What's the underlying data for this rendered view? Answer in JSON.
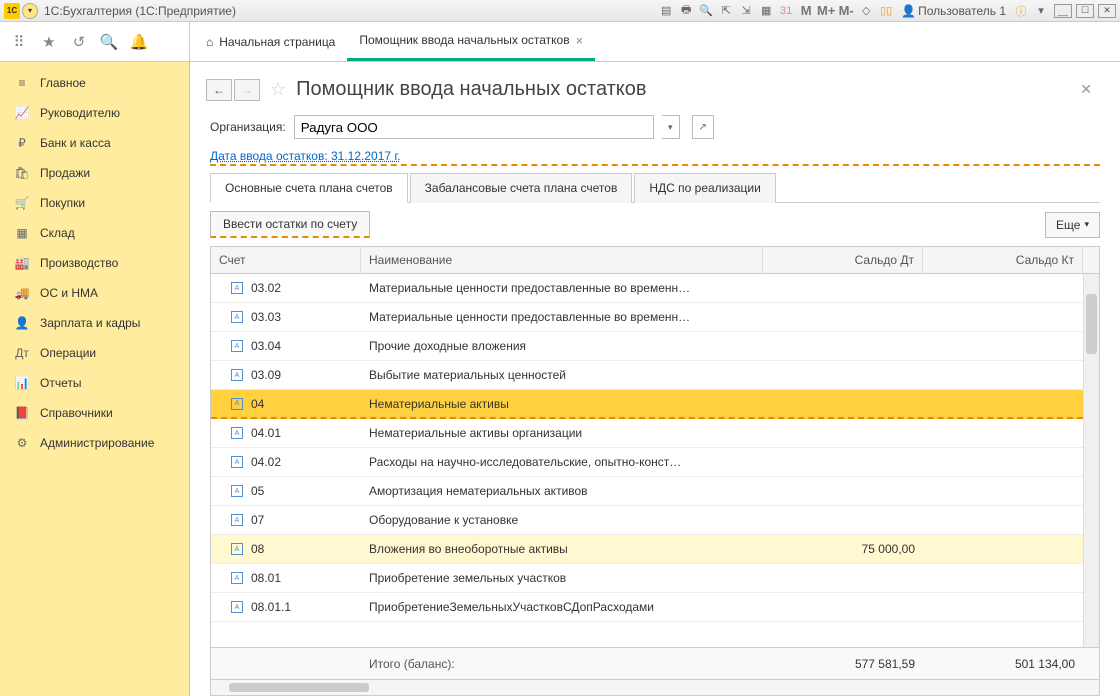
{
  "titlebar": {
    "app_icon_text": "1C",
    "title": "1С:Бухгалтерия  (1С:Предприятие)",
    "user": "Пользователь 1"
  },
  "top_tabs": {
    "home": "Начальная страница",
    "active": "Помощник ввода начальных остатков"
  },
  "sidebar": {
    "items": [
      {
        "icon": "≡",
        "label": "Главное"
      },
      {
        "icon": "📈",
        "label": "Руководителю"
      },
      {
        "icon": "₽",
        "label": "Банк и касса"
      },
      {
        "icon": "🛍",
        "label": "Продажи"
      },
      {
        "icon": "🛒",
        "label": "Покупки"
      },
      {
        "icon": "▦",
        "label": "Склад"
      },
      {
        "icon": "🏭",
        "label": "Производство"
      },
      {
        "icon": "🚚",
        "label": "ОС и НМА"
      },
      {
        "icon": "👤",
        "label": "Зарплата и кадры"
      },
      {
        "icon": "Дт",
        "label": "Операции"
      },
      {
        "icon": "📊",
        "label": "Отчеты"
      },
      {
        "icon": "📕",
        "label": "Справочники"
      },
      {
        "icon": "⚙",
        "label": "Администрирование"
      }
    ]
  },
  "page": {
    "title": "Помощник ввода начальных остатков",
    "org_label": "Организация:",
    "org_value": "Радуга ООО",
    "date_link": "Дата ввода остатков: 31.12.2017 г.",
    "tabs": [
      "Основные счета плана счетов",
      "Забалансовые счета плана счетов",
      "НДС по реализации"
    ],
    "action_btn": "Ввести остатки по счету",
    "more_btn": "Еще",
    "columns": {
      "acc": "Счет",
      "name": "Наименование",
      "dt": "Сальдо Дт",
      "kt": "Сальдо Кт"
    },
    "rows": [
      {
        "acc": "03.02",
        "name": "Материальные ценности предоставленные во временн…",
        "dt": "",
        "kt": ""
      },
      {
        "acc": "03.03",
        "name": "Материальные ценности предоставленные во временн…",
        "dt": "",
        "kt": ""
      },
      {
        "acc": "03.04",
        "name": "Прочие доходные вложения",
        "dt": "",
        "kt": ""
      },
      {
        "acc": "03.09",
        "name": "Выбытие материальных ценностей",
        "dt": "",
        "kt": ""
      },
      {
        "acc": "04",
        "name": "Нематериальные активы",
        "dt": "",
        "kt": "",
        "selected": true
      },
      {
        "acc": "04.01",
        "name": "Нематериальные активы организации",
        "dt": "",
        "kt": ""
      },
      {
        "acc": "04.02",
        "name": "Расходы на научно-исследовательские, опытно-конст…",
        "dt": "",
        "kt": ""
      },
      {
        "acc": "05",
        "name": "Амортизация нематериальных активов",
        "dt": "",
        "kt": ""
      },
      {
        "acc": "07",
        "name": "Оборудование к установке",
        "dt": "",
        "kt": ""
      },
      {
        "acc": "08",
        "name": "Вложения во внеоборотные активы",
        "dt": "75 000,00",
        "kt": "",
        "highlight": true
      },
      {
        "acc": "08.01",
        "name": "Приобретение земельных участков",
        "dt": "",
        "kt": ""
      },
      {
        "acc": "08.01.1",
        "name": "ПриобретениеЗемельныхУчастковСДопРасходами",
        "dt": "",
        "kt": ""
      }
    ],
    "footer": {
      "label": "Итого (баланс):",
      "dt": "577 581,59",
      "kt": "501 134,00"
    }
  }
}
